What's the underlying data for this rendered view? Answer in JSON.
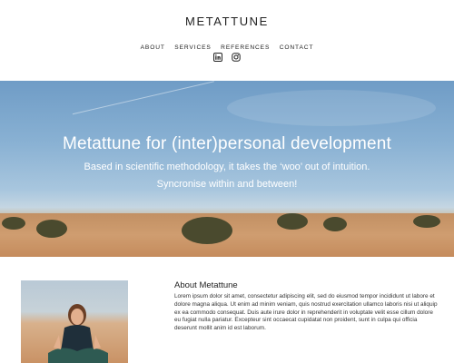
{
  "site": {
    "title": "METATTUNE"
  },
  "nav": {
    "items": [
      "ABOUT",
      "SERVICES",
      "REFERENCES",
      "CONTACT"
    ]
  },
  "social": {
    "icons": [
      "linkedin-icon",
      "instagram-icon"
    ]
  },
  "hero": {
    "title": "Metattune for (inter)personal development",
    "subtitle_line1": "Based in scientific methodology, it takes the ‘woo’ out of intuition.",
    "subtitle_line2": "Syncronise within and between!"
  },
  "about": {
    "title": "About Metattune",
    "body": "Lorem ipsum dolor sit amet, consectetur adipiscing elit, sed do eiusmod tempor incididunt ut labore et dolore magna aliqua. Ut enim ad minim veniam, quis nostrud exercitation ullamco laboris nisi ut aliquip ex ea commodo consequat. Duis aute irure dolor in reprehenderit in voluptate velit esse cillum dolore eu fugiat nulla pariatur. Excepteur sint occaecat cupidatat non proident, sunt in culpa qui officia deserunt mollit anim id est laborum."
  },
  "colors": {
    "text": "#222222",
    "hero_text": "#ffffff",
    "sky": "#89b1d3",
    "sand": "#c99a6c"
  }
}
